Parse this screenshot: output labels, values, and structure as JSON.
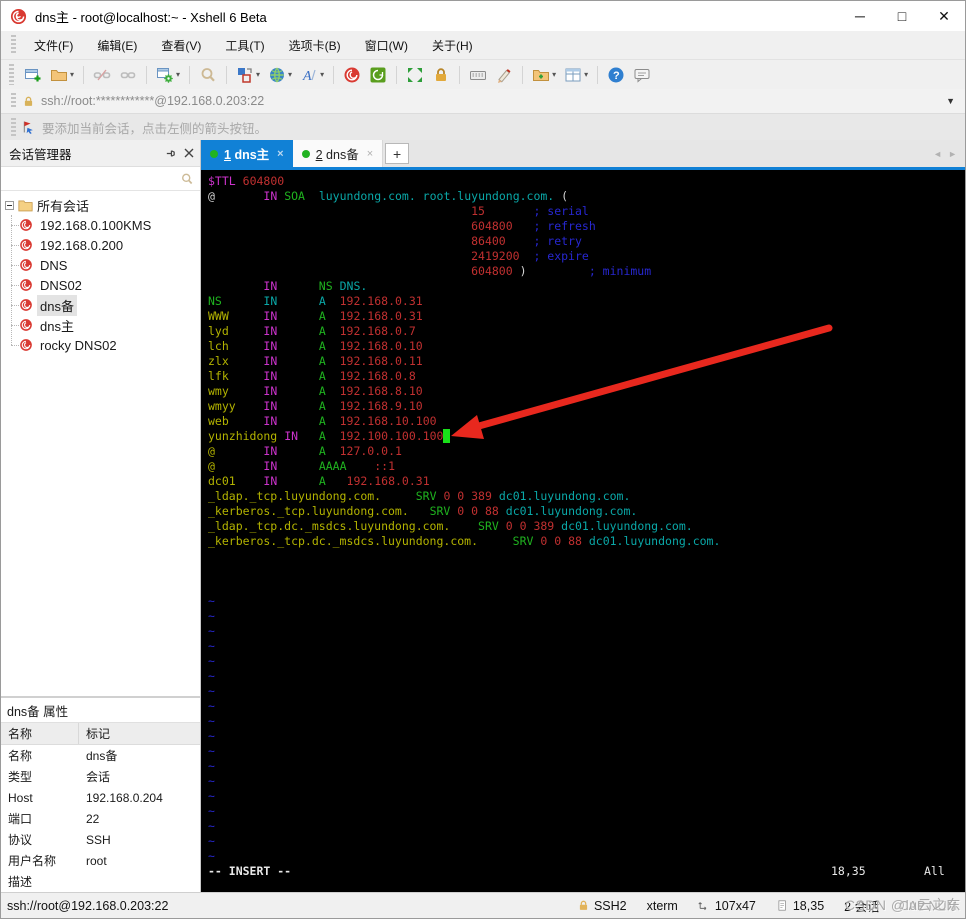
{
  "window": {
    "title": "dns主 - root@localhost:~ - Xshell 6 Beta"
  },
  "menu": {
    "items": [
      "文件(F)",
      "编辑(E)",
      "查看(V)",
      "工具(T)",
      "选项卡(B)",
      "窗口(W)",
      "关于(H)"
    ]
  },
  "address_bar": {
    "url": "ssh://root:************@192.168.0.203:22"
  },
  "info_bar": {
    "text": "要添加当前会话，点击左侧的箭头按钮。"
  },
  "session_manager": {
    "title": "会话管理器",
    "root_label": "所有会话",
    "selected": "dns备",
    "sessions": [
      "192.168.0.100KMS",
      "192.168.0.200",
      "DNS",
      "DNS02",
      "dns备",
      "dns主",
      "rocky DNS02"
    ]
  },
  "properties": {
    "title": "dns备 属性",
    "columns": [
      "名称",
      "标记"
    ],
    "rows": [
      [
        "名称",
        "dns备"
      ],
      [
        "类型",
        "会话"
      ],
      [
        "Host",
        "192.168.0.204"
      ],
      [
        "端口",
        "22"
      ],
      [
        "协议",
        "SSH"
      ],
      [
        "用户名称",
        "root"
      ],
      [
        "描述",
        ""
      ]
    ]
  },
  "tabs": [
    {
      "number": "1",
      "title": "dns主",
      "active": true
    },
    {
      "number": "2",
      "title": "dns备",
      "active": false
    }
  ],
  "new_tab_label": "+",
  "terminal": {
    "palette": {
      "w": "#d4d4d4",
      "m": "#cc33cc",
      "r": "#c03030",
      "g": "#1fb31f",
      "c": "#0aa8a8",
      "y": "#b3b300",
      "b": "#2727d0"
    },
    "cursor_color": "#19e019",
    "lines": [
      [
        [
          "m",
          "$TTL"
        ],
        [
          "w",
          " "
        ],
        [
          "r",
          "604800"
        ]
      ],
      [
        [
          "w",
          "@       "
        ],
        [
          "m",
          "IN"
        ],
        [
          "w",
          " "
        ],
        [
          "g",
          "SOA"
        ],
        [
          "w",
          "  "
        ],
        [
          "c",
          "luyundong.com. root.luyundong.com."
        ],
        [
          "w",
          " ("
        ]
      ],
      [
        [
          "w",
          "                                      "
        ],
        [
          "r",
          "15"
        ],
        [
          "w",
          "       "
        ],
        [
          "b",
          "; serial"
        ]
      ],
      [
        [
          "w",
          "                                      "
        ],
        [
          "r",
          "604800"
        ],
        [
          "w",
          "   "
        ],
        [
          "b",
          "; refresh"
        ]
      ],
      [
        [
          "w",
          "                                      "
        ],
        [
          "r",
          "86400"
        ],
        [
          "w",
          "    "
        ],
        [
          "b",
          "; retry"
        ]
      ],
      [
        [
          "w",
          "                                      "
        ],
        [
          "r",
          "2419200"
        ],
        [
          "w",
          "  "
        ],
        [
          "b",
          "; expire"
        ]
      ],
      [
        [
          "w",
          "                                      "
        ],
        [
          "r",
          "604800"
        ],
        [
          "w",
          " )         "
        ],
        [
          "b",
          "; minimum"
        ]
      ],
      [
        [
          "w",
          "        "
        ],
        [
          "m",
          "IN"
        ],
        [
          "w",
          "      "
        ],
        [
          "g",
          "NS"
        ],
        [
          "w",
          " "
        ],
        [
          "c",
          "DNS."
        ]
      ],
      [
        [
          "g",
          "NS"
        ],
        [
          "w",
          "      "
        ],
        [
          "c",
          "IN"
        ],
        [
          "w",
          "      "
        ],
        [
          "c",
          "A"
        ],
        [
          "w",
          "  "
        ],
        [
          "r",
          "192.168.0.31"
        ]
      ],
      [
        [
          "y",
          "WWW"
        ],
        [
          "w",
          "     "
        ],
        [
          "m",
          "IN"
        ],
        [
          "w",
          "      "
        ],
        [
          "g",
          "A"
        ],
        [
          "w",
          "  "
        ],
        [
          "r",
          "192.168.0.31"
        ]
      ],
      [
        [
          "y",
          "lyd"
        ],
        [
          "w",
          "     "
        ],
        [
          "m",
          "IN"
        ],
        [
          "w",
          "      "
        ],
        [
          "g",
          "A"
        ],
        [
          "w",
          "  "
        ],
        [
          "r",
          "192.168.0.7"
        ]
      ],
      [
        [
          "y",
          "lch"
        ],
        [
          "w",
          "     "
        ],
        [
          "m",
          "IN"
        ],
        [
          "w",
          "      "
        ],
        [
          "g",
          "A"
        ],
        [
          "w",
          "  "
        ],
        [
          "r",
          "192.168.0.10"
        ]
      ],
      [
        [
          "y",
          "zlx"
        ],
        [
          "w",
          "     "
        ],
        [
          "m",
          "IN"
        ],
        [
          "w",
          "      "
        ],
        [
          "g",
          "A"
        ],
        [
          "w",
          "  "
        ],
        [
          "r",
          "192.168.0.11"
        ]
      ],
      [
        [
          "y",
          "lfk"
        ],
        [
          "w",
          "     "
        ],
        [
          "m",
          "IN"
        ],
        [
          "w",
          "      "
        ],
        [
          "g",
          "A"
        ],
        [
          "w",
          "  "
        ],
        [
          "r",
          "192.168.0.8"
        ]
      ],
      [
        [
          "y",
          "wmy"
        ],
        [
          "w",
          "     "
        ],
        [
          "m",
          "IN"
        ],
        [
          "w",
          "      "
        ],
        [
          "g",
          "A"
        ],
        [
          "w",
          "  "
        ],
        [
          "r",
          "192.168.8.10"
        ]
      ],
      [
        [
          "y",
          "wmyy"
        ],
        [
          "w",
          "    "
        ],
        [
          "m",
          "IN"
        ],
        [
          "w",
          "      "
        ],
        [
          "g",
          "A"
        ],
        [
          "w",
          "  "
        ],
        [
          "r",
          "192.168.9.10"
        ]
      ],
      [
        [
          "y",
          "web"
        ],
        [
          "w",
          "     "
        ],
        [
          "m",
          "IN"
        ],
        [
          "w",
          "      "
        ],
        [
          "g",
          "A"
        ],
        [
          "w",
          "  "
        ],
        [
          "r",
          "192.168.10.100"
        ]
      ],
      [
        [
          "y",
          "yunzhidong"
        ],
        [
          "w",
          " "
        ],
        [
          "m",
          "IN"
        ],
        [
          "w",
          "   "
        ],
        [
          "g",
          "A"
        ],
        [
          "w",
          "  "
        ],
        [
          "r",
          "192.100.100.100"
        ],
        [
          "k",
          " "
        ]
      ],
      [
        [
          "y",
          "@"
        ],
        [
          "w",
          "       "
        ],
        [
          "m",
          "IN"
        ],
        [
          "w",
          "      "
        ],
        [
          "g",
          "A"
        ],
        [
          "w",
          "  "
        ],
        [
          "r",
          "127.0.0.1"
        ]
      ],
      [
        [
          "y",
          "@"
        ],
        [
          "w",
          "       "
        ],
        [
          "m",
          "IN"
        ],
        [
          "w",
          "      "
        ],
        [
          "g",
          "AAAA"
        ],
        [
          "w",
          "    "
        ],
        [
          "r",
          "::1"
        ]
      ],
      [
        [
          "y",
          "dc01"
        ],
        [
          "w",
          "    "
        ],
        [
          "m",
          "IN"
        ],
        [
          "w",
          "      "
        ],
        [
          "g",
          "A"
        ],
        [
          "w",
          "   "
        ],
        [
          "r",
          "192.168.0.31"
        ]
      ],
      [
        [
          "y",
          "_ldap._tcp.luyundong.com."
        ],
        [
          "w",
          "     "
        ],
        [
          "g",
          "SRV"
        ],
        [
          "w",
          " "
        ],
        [
          "r",
          "0 0 389"
        ],
        [
          "w",
          " "
        ],
        [
          "c",
          "dc01.luyundong.com."
        ]
      ],
      [
        [
          "y",
          "_kerberos._tcp.luyundong.com."
        ],
        [
          "w",
          "   "
        ],
        [
          "g",
          "SRV"
        ],
        [
          "w",
          " "
        ],
        [
          "r",
          "0 0 88"
        ],
        [
          "w",
          " "
        ],
        [
          "c",
          "dc01.luyundong.com."
        ]
      ],
      [
        [
          "y",
          "_ldap._tcp.dc._msdcs.luyundong.com."
        ],
        [
          "w",
          "    "
        ],
        [
          "g",
          "SRV"
        ],
        [
          "w",
          " "
        ],
        [
          "r",
          "0 0 389"
        ],
        [
          "w",
          " "
        ],
        [
          "c",
          "dc01.luyundong.com."
        ]
      ],
      [
        [
          "y",
          "_kerberos._tcp.dc._msdcs.luyundong.com."
        ],
        [
          "w",
          "     "
        ],
        [
          "g",
          "SRV"
        ],
        [
          "w",
          " "
        ],
        [
          "r",
          "0 0 88"
        ],
        [
          "w",
          " "
        ],
        [
          "c",
          "dc01.luyundong.com."
        ]
      ],
      [],
      [],
      []
    ],
    "tilde_count": 18,
    "status": {
      "mode": "-- INSERT --",
      "ruler": "18,35",
      "scroll": "All"
    }
  },
  "status_bar": {
    "left": "ssh://root@192.168.0.203:22",
    "encryption": "SSH2",
    "term_type": "xterm",
    "size": "107x47",
    "cursor": "18,35",
    "sessions": "2 会话",
    "lock_state": "CAP NUM"
  },
  "watermark": "CSDN @lu云之东",
  "colors": {
    "accent_blue": "#1181d6",
    "arrow_red": "#e8281e",
    "session_icon_red": "#d93a32",
    "green_dot": "#21b321"
  }
}
